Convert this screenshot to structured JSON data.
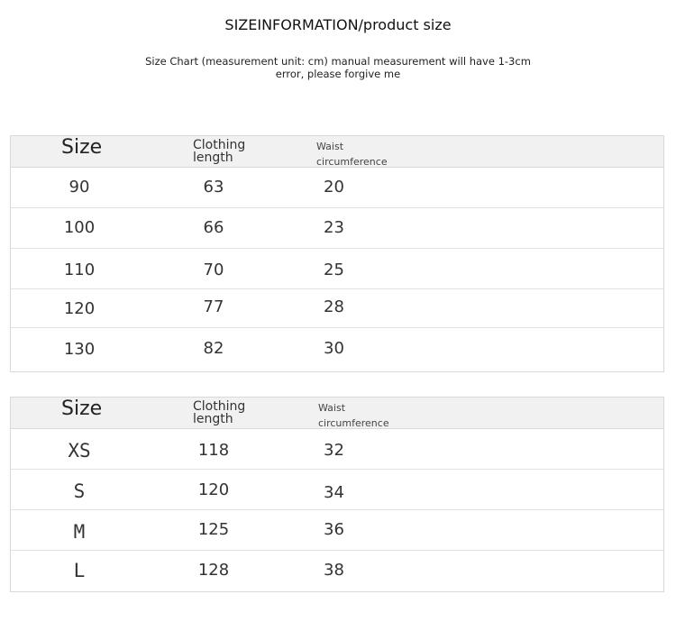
{
  "header": {
    "title": "SIZEINFORMATION/product size",
    "note_line1": "Size Chart (measurement unit: cm) manual measurement will have 1-3cm",
    "note_line2": "error, please forgive me"
  },
  "tables": [
    {
      "columns": {
        "size": "Size",
        "length_line1": "Clothing",
        "length_line2": "length",
        "waist_line1": "Waist",
        "waist_line2": "circumference"
      },
      "rows": [
        {
          "size": "90",
          "length": "63",
          "waist": "20"
        },
        {
          "size": "100",
          "length": "66",
          "waist": "23"
        },
        {
          "size": "110",
          "length": "70",
          "waist": "25"
        },
        {
          "size": "120",
          "length": "77",
          "waist": "28"
        },
        {
          "size": "130",
          "length": "82",
          "waist": "30"
        }
      ]
    },
    {
      "columns": {
        "size": "Size",
        "length_line1": "Clothing",
        "length_line2": "length",
        "waist_line1": "Waist",
        "waist_line2": "circumference"
      },
      "rows": [
        {
          "size": "XS",
          "length": "118",
          "waist": "32"
        },
        {
          "size": "S",
          "length": "120",
          "waist": "34"
        },
        {
          "size": "M",
          "length": "125",
          "waist": "36"
        },
        {
          "size": "L",
          "length": "128",
          "waist": "38"
        }
      ]
    }
  ]
}
